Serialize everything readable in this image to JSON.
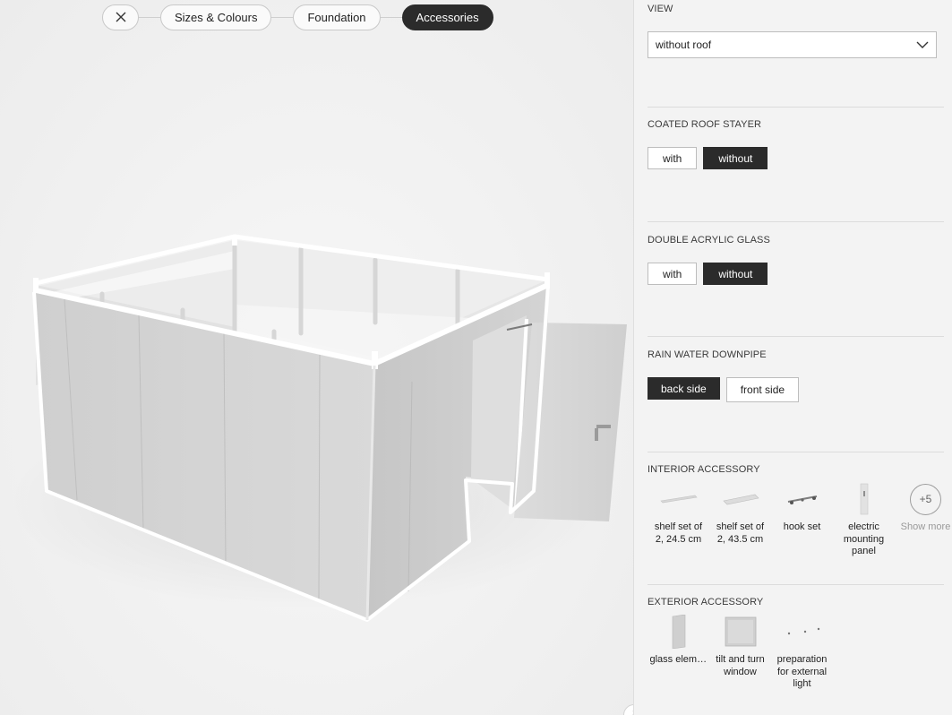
{
  "stepper": {
    "steps": [
      {
        "label": "Sizes & Colours",
        "active": false
      },
      {
        "label": "Foundation",
        "active": false
      },
      {
        "label": "Accessories",
        "active": true
      }
    ]
  },
  "panel": {
    "view": {
      "title": "VIEW",
      "selected": "without roof"
    },
    "coated_roof_stayer": {
      "title": "COATED ROOF STAYER",
      "options": [
        "with",
        "without"
      ],
      "selected": "without"
    },
    "double_acrylic_glass": {
      "title": "DOUBLE ACRYLIC GLASS",
      "options": [
        "with",
        "without"
      ],
      "selected": "without"
    },
    "rain_water_downpipe": {
      "title": "RAIN WATER DOWNPIPE",
      "options": [
        "back side",
        "front side"
      ],
      "selected": "back side"
    },
    "interior_accessory": {
      "title": "INTERIOR ACCESSORY",
      "items": [
        {
          "label": "shelf set of 2, 24.5 cm",
          "icon": "shelf-short-icon"
        },
        {
          "label": "shelf set of 2, 43.5 cm",
          "icon": "shelf-long-icon"
        },
        {
          "label": "hook set",
          "icon": "hook-set-icon"
        },
        {
          "label": "electric mounting panel",
          "icon": "mounting-panel-icon"
        }
      ],
      "more": {
        "count": "+5",
        "label": "Show more"
      }
    },
    "exterior_accessory": {
      "title": "EXTERIOR ACCESSORY",
      "items": [
        {
          "label": "glass element",
          "icon": "glass-element-icon"
        },
        {
          "label": "tilt and turn window",
          "icon": "window-icon"
        },
        {
          "label": "preparation for external light",
          "icon": "light-prep-icon"
        }
      ]
    }
  },
  "colors": {
    "active": "#2b2b2b",
    "border": "#bdbdbd",
    "panel_bg": "#f3f3f3"
  }
}
